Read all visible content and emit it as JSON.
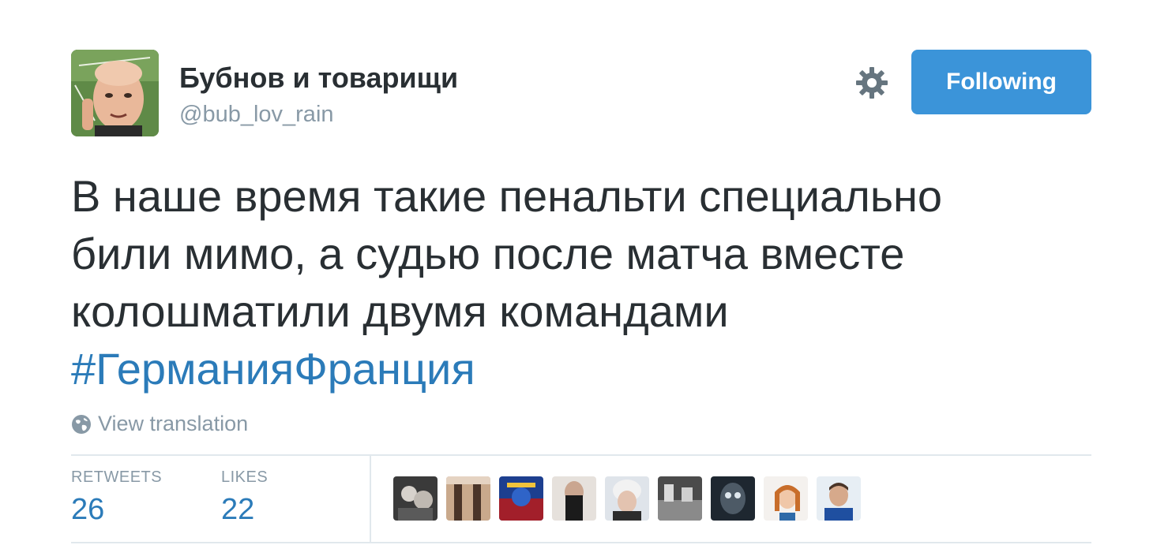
{
  "user": {
    "display_name": "Бубнов и товарищи",
    "handle": "@bub_lov_rain",
    "avatar_icon": "profile-photo"
  },
  "actions": {
    "settings_icon": "gear-icon",
    "follow_label": "Following",
    "follow_color": "#3b94d9"
  },
  "tweet": {
    "lines": [
      "В наше время такие пенальти специально",
      "били мимо, а судью после матча вместе",
      "колошматили двумя командами"
    ],
    "hashtag": "#ГерманияФранция",
    "hashtag_color": "#2b7bb9"
  },
  "translation": {
    "icon": "globe-icon",
    "label": "View translation"
  },
  "stats": {
    "retweets_label": "RETWEETS",
    "retweets_count": "26",
    "likes_label": "LIKES",
    "likes_count": "22"
  },
  "likers": [
    {
      "name": "liker-avatar-1"
    },
    {
      "name": "liker-avatar-2"
    },
    {
      "name": "liker-avatar-3"
    },
    {
      "name": "liker-avatar-4"
    },
    {
      "name": "liker-avatar-5"
    },
    {
      "name": "liker-avatar-6"
    },
    {
      "name": "liker-avatar-7"
    },
    {
      "name": "liker-avatar-8"
    },
    {
      "name": "liker-avatar-9"
    }
  ]
}
